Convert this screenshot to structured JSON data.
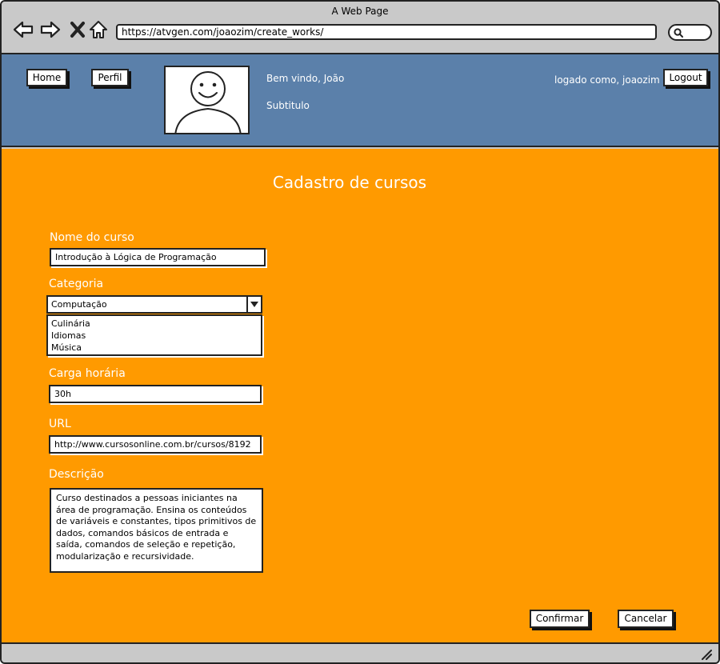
{
  "browser": {
    "window_title": "A Web Page",
    "url": "https://atvgen.com/joaozim/create_works/"
  },
  "header": {
    "home_label": "Home",
    "perfil_label": "Perfil",
    "welcome": "Bem vindo, João",
    "subtitle": "Subtitulo",
    "logged_as": "logado como, joaozim",
    "logout_label": "Logout"
  },
  "form": {
    "title": "Cadastro de cursos",
    "nome_label": "Nome do curso",
    "nome_value": "Introdução à Lógica de Programação",
    "categoria_label": "Categoria",
    "categoria_value": "Computação",
    "categoria_options": [
      "Culinária",
      "Idiomas",
      "Música"
    ],
    "carga_label": "Carga horária",
    "carga_value": "30h",
    "url_label": "URL",
    "url_value": "http://www.cursosonline.com.br/cursos/8192",
    "descricao_label": "Descrição",
    "descricao_value": "Curso destinados a pessoas iniciantes na área de programação. Ensina os conteúdos de variáveis e constantes, tipos primitivos de dados, comandos básicos de entrada e saída, comandos de seleção e repetição, modularização e recursividade.",
    "confirm_label": "Confirmar",
    "cancel_label": "Cancelar"
  },
  "colors": {
    "header_bg": "#5b80aa",
    "main_bg": "#ff9a00",
    "chrome_bg": "#c9c9c9"
  }
}
